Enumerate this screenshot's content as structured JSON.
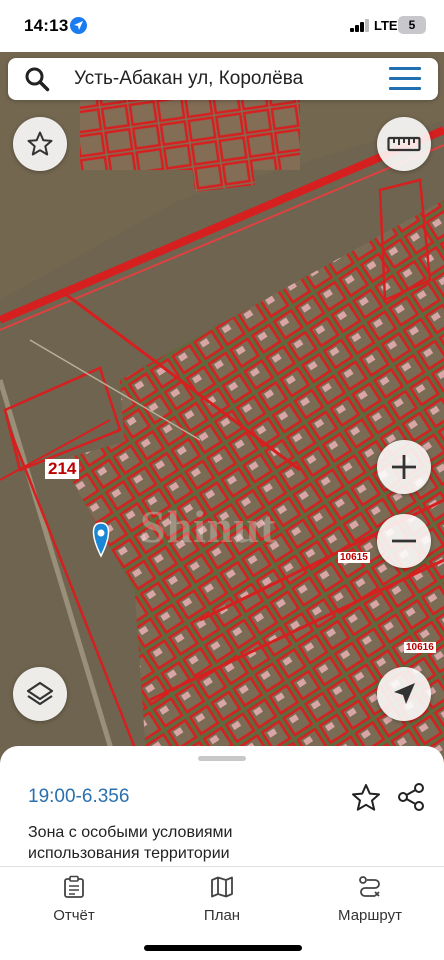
{
  "status": {
    "time": "14:13",
    "network": "LTE",
    "battery": "5"
  },
  "search": {
    "text": "Усть-Абакан ул, Королёва"
  },
  "map": {
    "parcel_label": "214",
    "label_a": "10615",
    "label_b": "10616",
    "watermark": "Shinut"
  },
  "info": {
    "code": "19:00-6.356",
    "description": "Зона с особыми условиями использования территории"
  },
  "nav": {
    "report": "Отчёт",
    "plan": "План",
    "route": "Маршрут"
  },
  "colors": {
    "accent": "#1f6fb2",
    "boundary": "#d61f1f"
  }
}
